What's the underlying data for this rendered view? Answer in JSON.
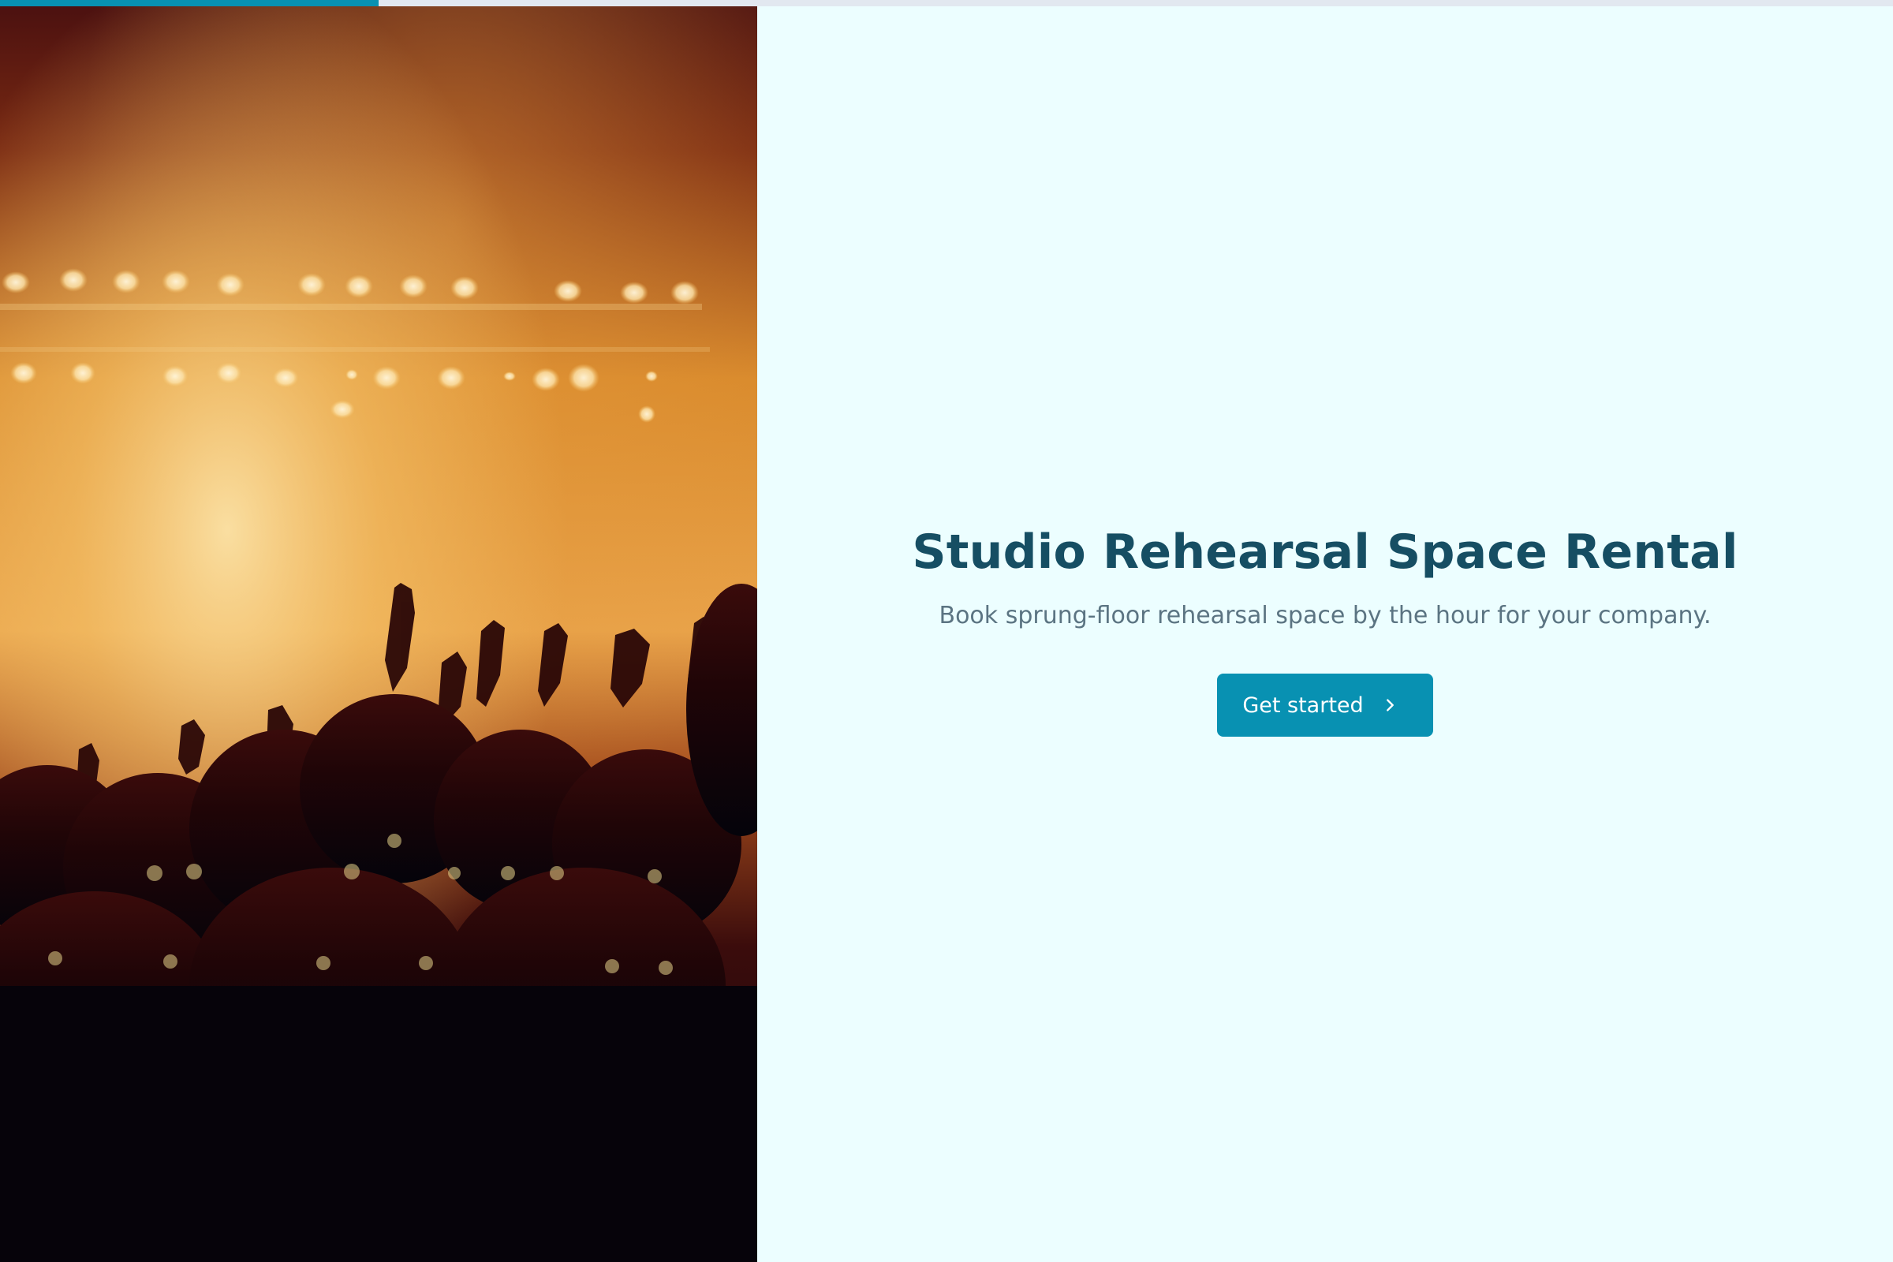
{
  "progress": {
    "value": 0.2
  },
  "hero": {
    "image_description_icon": "concert-crowd-photo",
    "accent_colors": [
      "#f5c36a",
      "#d98a2c",
      "#2a0707"
    ]
  },
  "main": {
    "title": "Studio Rehearsal Space Rental",
    "subtitle": "Book sprung-floor rehearsal space by the hour for your company.",
    "cta": {
      "label": "Get started",
      "icon": "chevron-right-icon"
    }
  },
  "colors": {
    "accent": "#0891b2",
    "background": "#ecfeff",
    "title": "#164e63",
    "subtitle": "#5b7482",
    "track": "#e2e8f0"
  }
}
